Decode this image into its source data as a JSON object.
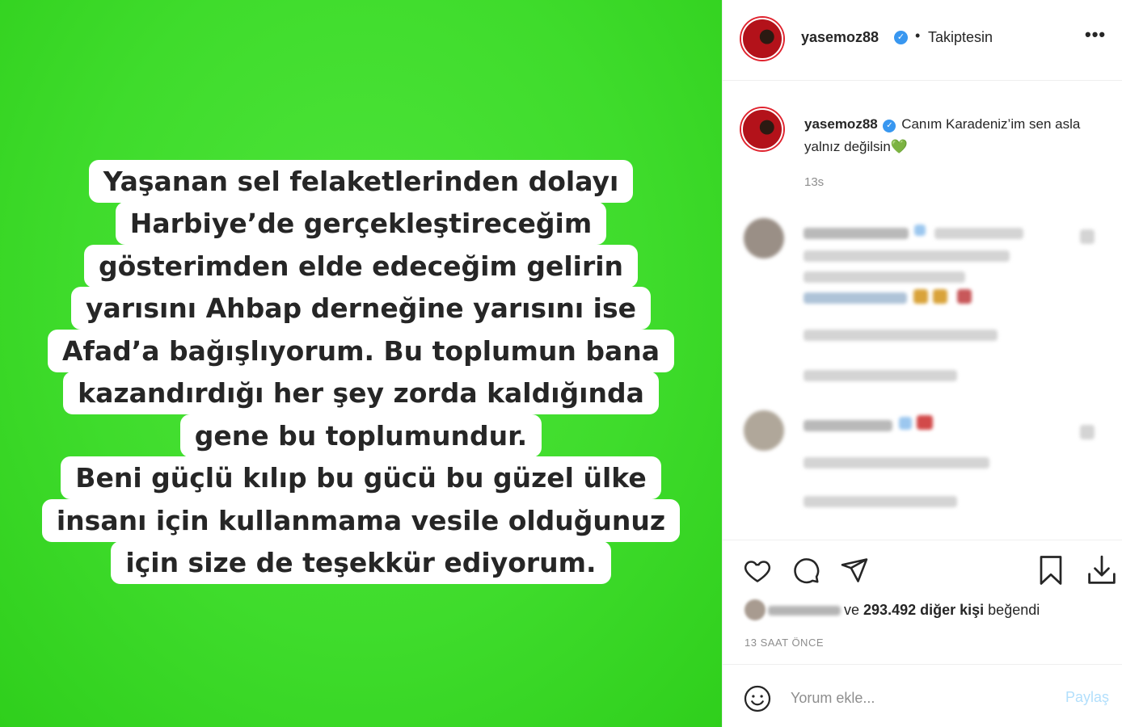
{
  "media": {
    "background_color": "#3fdc2c",
    "story_lines": [
      "Yaşanan sel felaketlerinden dolayı",
      "Harbiye’de gerçekleştireceğim",
      "gösterimden elde edeceğim gelirin",
      "yarısını Ahbap derneğine yarısını ise",
      "Afad’a bağışlıyorum. Bu toplumun bana",
      "kazandırdığı her şey zorda kaldığında",
      "gene bu toplumundur.",
      "Beni güçlü kılıp bu gücü bu güzel ülke",
      "insanı için kullanmama vesile olduğunuz",
      "için size de teşekkür ediyorum."
    ]
  },
  "header": {
    "username": "yasemoz88",
    "separator": "•",
    "follow_status": "Takiptesin",
    "more_icon": "more-horizontal-icon"
  },
  "caption": {
    "username": "yasemoz88",
    "text": "Canım Karadeniz’im sen asla yalnız değilsin",
    "emoji": "green-heart",
    "time": "13s"
  },
  "actions": {
    "like_icon": "heart-icon",
    "comment_icon": "comment-icon",
    "share_icon": "send-icon",
    "save_icon": "bookmark-icon",
    "download_icon": "download-icon"
  },
  "likes": {
    "prefix": "ve",
    "count": "293.492",
    "suffix_bold": "diğer kişi",
    "suffix": "beğendi"
  },
  "timestamp": "13 SAAT ÖNCE",
  "comment_box": {
    "placeholder": "Yorum ekle...",
    "post_label": "Paylaş"
  },
  "colors": {
    "verified": "#3897f0",
    "accent_link": "#b2dffc",
    "text": "#262626",
    "muted": "#8e8e8e"
  }
}
